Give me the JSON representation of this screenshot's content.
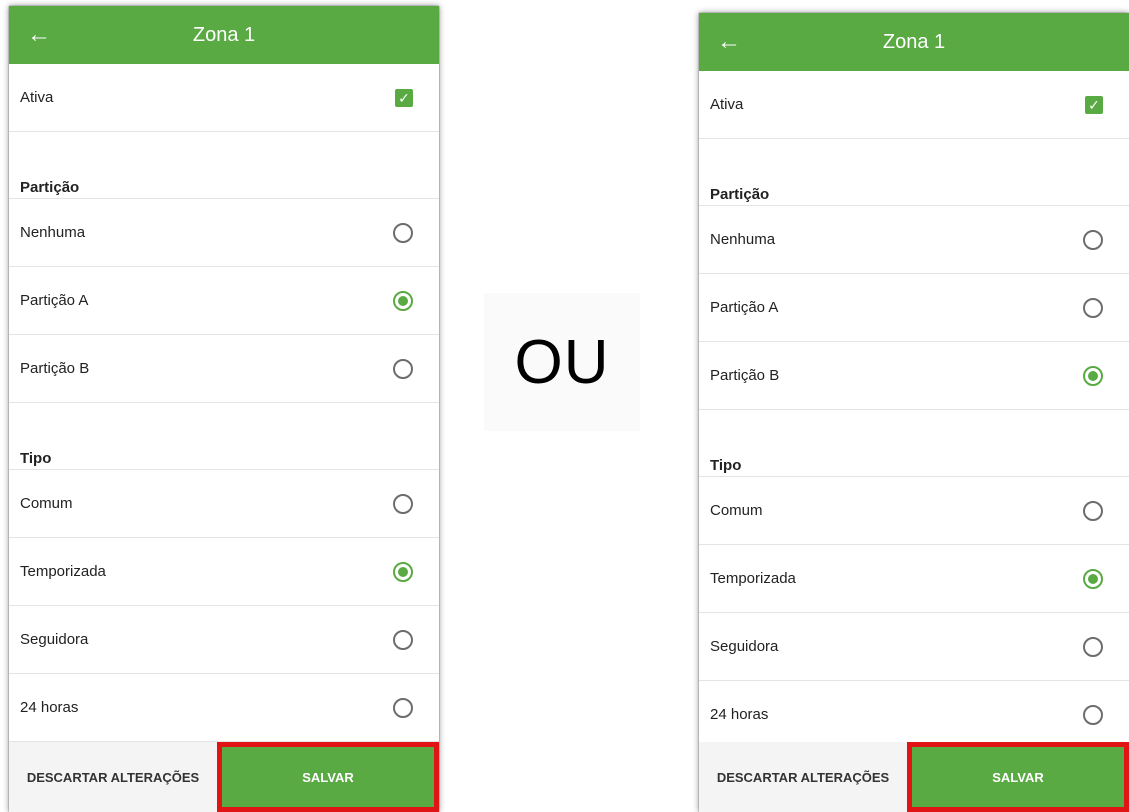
{
  "separator_text": "OU",
  "accent_color": "#5aaa44",
  "highlight_color": "#e01414",
  "screens": [
    {
      "back_icon": "arrow-left-icon",
      "title": "Zona 1",
      "ativa": {
        "label": "Ativa",
        "checked": true
      },
      "particao": {
        "header": "Partição",
        "options": [
          {
            "label": "Nenhuma",
            "selected": false
          },
          {
            "label": "Partição A",
            "selected": true
          },
          {
            "label": "Partição B",
            "selected": false
          }
        ]
      },
      "tipo": {
        "header": "Tipo",
        "options": [
          {
            "label": "Comum",
            "selected": false
          },
          {
            "label": "Temporizada",
            "selected": true
          },
          {
            "label": "Seguidora",
            "selected": false
          },
          {
            "label": "24 horas",
            "selected": false
          }
        ]
      },
      "footer": {
        "discard_label": "DESCARTAR ALTERAÇÕES",
        "save_label": "SALVAR"
      }
    },
    {
      "back_icon": "arrow-left-icon",
      "title": "Zona 1",
      "ativa": {
        "label": "Ativa",
        "checked": true
      },
      "particao": {
        "header": "Partição",
        "options": [
          {
            "label": "Nenhuma",
            "selected": false
          },
          {
            "label": "Partição A",
            "selected": false
          },
          {
            "label": "Partição B",
            "selected": true
          }
        ]
      },
      "tipo": {
        "header": "Tipo",
        "options": [
          {
            "label": "Comum",
            "selected": false
          },
          {
            "label": "Temporizada",
            "selected": true
          },
          {
            "label": "Seguidora",
            "selected": false
          },
          {
            "label": "24 horas",
            "selected": false
          }
        ]
      },
      "footer": {
        "discard_label": "DESCARTAR ALTERAÇÕES",
        "save_label": "SALVAR"
      }
    }
  ]
}
